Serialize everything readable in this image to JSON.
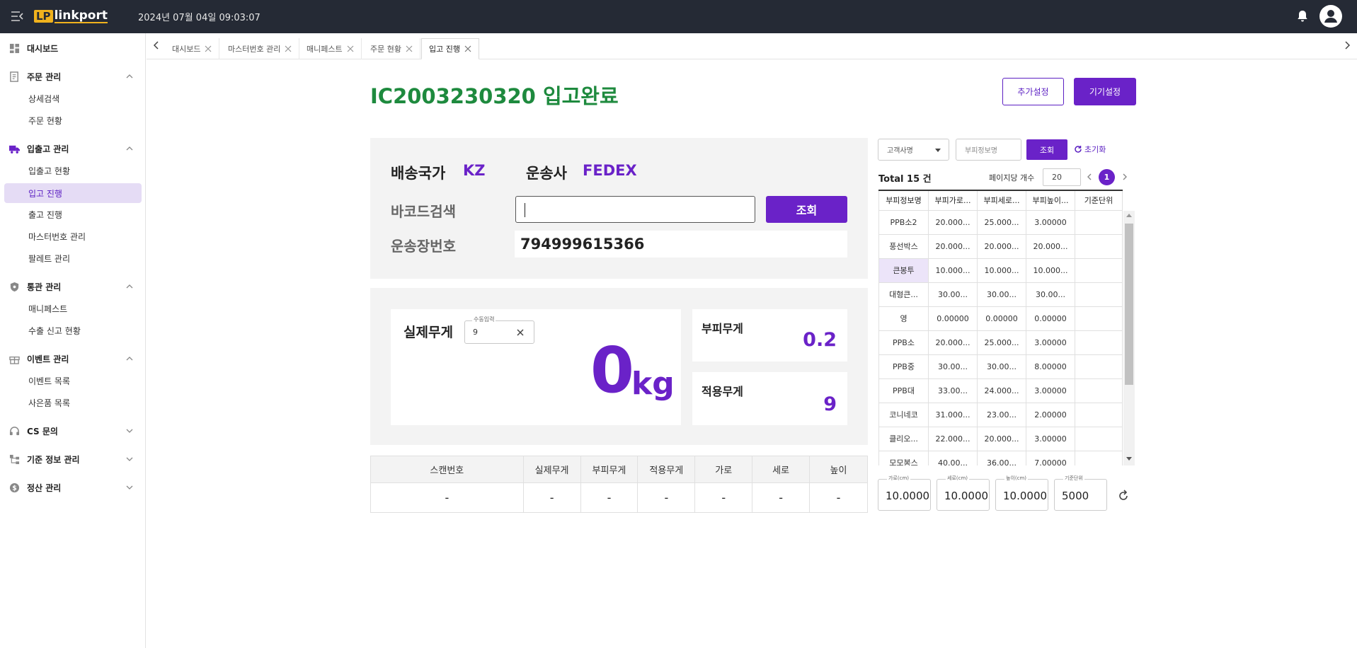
{
  "header": {
    "logo_lp": "LP",
    "logo_text": "linkport",
    "datetime": "2024년 07월 04일 09:03:07"
  },
  "sidebar": {
    "dashboard": "대시보드",
    "order_mgmt": "주문 관리",
    "detail_search": "상세검색",
    "order_status": "주문 현황",
    "inout_mgmt": "입출고 관리",
    "inout_status": "입출고 현황",
    "inbound_progress": "입고 진행",
    "outbound_progress": "출고 진행",
    "master_no_mgmt": "마스터번호 관리",
    "pallet_mgmt": "팔레트 관리",
    "customs_mgmt": "통관 관리",
    "manifest": "매니페스트",
    "export_decl": "수출 신고 현황",
    "event_mgmt": "이벤트 관리",
    "event_list": "이벤트 목록",
    "gift_list": "사은품 목록",
    "cs_inquiry": "CS 문의",
    "base_info": "기준 정보 관리",
    "settlement": "정산 관리"
  },
  "tabs": [
    "대시보드",
    "마스터번호 관리",
    "매니페스트",
    "주문 현황",
    "입고 진행"
  ],
  "page": {
    "title": "IC2003230320 입고완료",
    "btn_extra": "추가설정",
    "btn_device": "기기설정"
  },
  "shipment": {
    "country_label": "배송국가",
    "country_value": "KZ",
    "carrier_label": "운송사",
    "carrier_value": "FEDEX",
    "barcode_label": "바코드검색",
    "search_btn": "조회",
    "waybill_label": "운송장번호",
    "waybill_value": "794999615366"
  },
  "weight": {
    "actual_label": "실제무게",
    "manual_legend": "수동입력",
    "manual_value": "9",
    "actual_value": "0",
    "unit": "kg",
    "volume_label": "부피무게",
    "volume_value": "0.2",
    "applied_label": "적용무게",
    "applied_value": "9"
  },
  "scan_table": {
    "headers": [
      "스캔번호",
      "실제무게",
      "부피무게",
      "적용무게",
      "가로",
      "세로",
      "높이"
    ],
    "row": [
      "-",
      "-",
      "-",
      "-",
      "-",
      "-",
      "-"
    ]
  },
  "volume_panel": {
    "customer_select": "고객사명",
    "volume_name_placeholder": "부피정보명",
    "search_btn": "조회",
    "reset": "초기화",
    "total": "Total 15 건",
    "per_page_label": "페이지당 개수",
    "per_page_value": "20",
    "page": "1",
    "headers": [
      "부피정보명",
      "부피가로...",
      "부피세로...",
      "부피높이...",
      "기준단위"
    ],
    "rows": [
      [
        "PPB소2",
        "20.000...",
        "25.000...",
        "3.00000",
        ""
      ],
      [
        "풍선박스",
        "20.000...",
        "20.000...",
        "20.000...",
        ""
      ],
      [
        "큰봉투",
        "10.000...",
        "10.000...",
        "10.000...",
        ""
      ],
      [
        "대형큰...",
        "30.00...",
        "30.00...",
        "30.00...",
        ""
      ],
      [
        "영",
        "0.00000",
        "0.00000",
        "0.00000",
        ""
      ],
      [
        "PPB소",
        "20.000...",
        "25.000...",
        "3.00000",
        ""
      ],
      [
        "PPB중",
        "30.00...",
        "30.00...",
        "8.00000",
        ""
      ],
      [
        "PPB대",
        "33.00...",
        "24.000...",
        "3.00000",
        ""
      ],
      [
        "코니네코",
        "31.000...",
        "23.00...",
        "2.00000",
        ""
      ],
      [
        "클리오...",
        "22.000...",
        "20.000...",
        "3.00000",
        ""
      ],
      [
        "모모봉스",
        "40.00...",
        "36.00...",
        "7.00000",
        ""
      ]
    ],
    "dims": [
      {
        "legend": "가로(cm)",
        "value": "10.0000"
      },
      {
        "legend": "세로(cm)",
        "value": "10.0000"
      },
      {
        "legend": "높이(cm)",
        "value": "10.0000"
      },
      {
        "legend": "기준단위",
        "value": "5000"
      }
    ]
  },
  "colors": {
    "accent": "#6a22c8",
    "title_green": "#1e8a3e",
    "topbar": "#252a35"
  }
}
